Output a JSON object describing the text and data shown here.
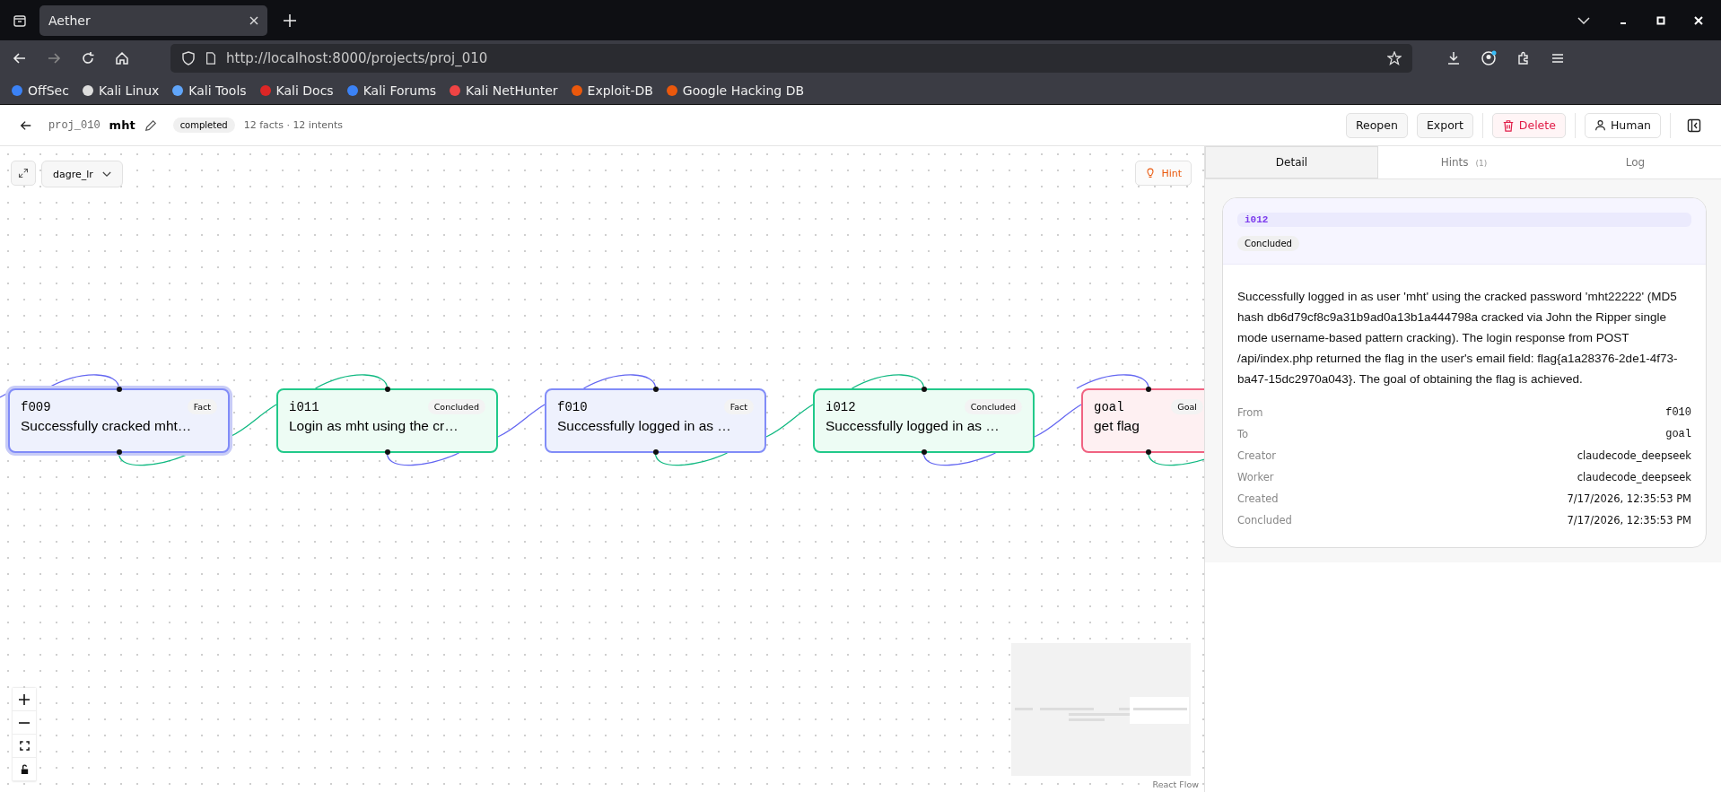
{
  "browser": {
    "tabs": [
      {
        "title": "Aether",
        "selected": true
      }
    ],
    "url": "http://localhost:8000/projects/proj_010",
    "bookmarks": [
      "OffSec",
      "Kali Linux",
      "Kali Tools",
      "Kali Docs",
      "Kali Forums",
      "Kali NetHunter",
      "Exploit-DB",
      "Google Hacking DB"
    ]
  },
  "header": {
    "project_id": "proj_010",
    "name": "mht",
    "status": "completed",
    "counts": "12 facts · 12 intents",
    "buttons": [
      {
        "label": "Reopen",
        "kind": "plain"
      },
      {
        "label": "Export",
        "kind": "plain"
      },
      {
        "label": "Delete",
        "kind": "danger"
      },
      {
        "label": "Human",
        "kind": "user"
      }
    ]
  },
  "canvas": {
    "layout": "dagre_lr",
    "hint": "Hint",
    "nodes": [
      {
        "id": "f009",
        "badge": "Fact",
        "text": "Successfully cracked mht…",
        "kind": "fact",
        "selected": true
      },
      {
        "id": "i011",
        "badge": "Concluded",
        "text": "Login as mht using the cr…",
        "kind": "intent",
        "selected": false
      },
      {
        "id": "f010",
        "badge": "Fact",
        "text": "Successfully logged in as …",
        "kind": "fact",
        "selected": false
      },
      {
        "id": "i012",
        "badge": "Concluded",
        "text": "Successfully logged in as …",
        "kind": "intent",
        "selected": false
      },
      {
        "id": "goal",
        "badge": "Goal",
        "text": "get flag",
        "kind": "goal",
        "selected": false
      }
    ],
    "attribution": "React Flow"
  },
  "panel": {
    "tabs": [
      {
        "label": "Detail",
        "selected": true
      },
      {
        "label": "Hints",
        "count": "(1)",
        "selected": false
      },
      {
        "label": "Log",
        "selected": false
      }
    ],
    "detail": {
      "id": "i012",
      "status": "Concluded",
      "description": "Successfully logged in as user 'mht' using the cracked password 'mht22222' (MD5 hash db6d79cf8c9a31b9ad0a13b1a444798a cracked via John the Ripper single mode username-based pattern cracking). The login response from POST /api/index.php returned the flag in the user's email field: flag{a1a28376-2de1-4f73-ba47-15dc2970a043}. The goal of obtaining the flag is achieved.",
      "fields": [
        {
          "label": "From",
          "value": "f010",
          "kind": "ref"
        },
        {
          "label": "To",
          "value": "goal",
          "kind": "ref"
        },
        {
          "label": "Creator",
          "value": "claudecode_deepseek",
          "kind": "text"
        },
        {
          "label": "Worker",
          "value": "claudecode_deepseek",
          "kind": "text"
        },
        {
          "label": "Created",
          "value": "7/17/2026, 12:35:53 PM",
          "kind": "text"
        },
        {
          "label": "Concluded",
          "value": "7/17/2026, 12:35:53 PM",
          "kind": "text"
        }
      ]
    }
  }
}
